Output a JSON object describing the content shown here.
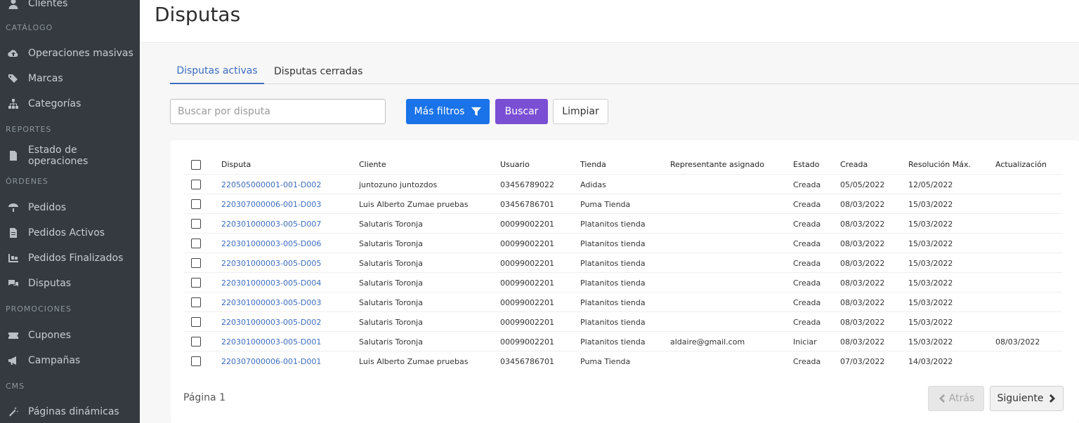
{
  "sidebar": {
    "top_item": {
      "label": "Clientes",
      "icon": "user-icon"
    },
    "sections": [
      {
        "title": "CATÁLOGO",
        "items": [
          {
            "label": "Operaciones masivas",
            "icon": "cloud-upload-icon"
          },
          {
            "label": "Marcas",
            "icon": "tags-icon"
          },
          {
            "label": "Categorías",
            "icon": "sitemap-icon"
          }
        ]
      },
      {
        "title": "REPORTES",
        "items": [
          {
            "label": "Estado de operaciones",
            "icon": "file-icon"
          }
        ]
      },
      {
        "title": "ÓRDENES",
        "items": [
          {
            "label": "Pedidos",
            "icon": "parachute-icon"
          },
          {
            "label": "Pedidos Activos",
            "icon": "file-text-icon"
          },
          {
            "label": "Pedidos Finalizados",
            "icon": "dolly-icon"
          },
          {
            "label": "Disputas",
            "icon": "comments-icon"
          }
        ]
      },
      {
        "title": "PROMOCIONES",
        "items": [
          {
            "label": "Cupones",
            "icon": "ticket-icon"
          },
          {
            "label": "Campañas",
            "icon": "bullhorn-icon"
          }
        ]
      },
      {
        "title": "CMS",
        "items": [
          {
            "label": "Páginas dinámicas",
            "icon": "magic-wand-icon"
          }
        ]
      }
    ]
  },
  "header": {
    "title": "Disputas"
  },
  "tabs": [
    {
      "label": "Disputas activas",
      "active": true
    },
    {
      "label": "Disputas cerradas",
      "active": false
    }
  ],
  "search": {
    "placeholder": "Buscar por disputa",
    "value": ""
  },
  "buttons": {
    "more_filters": "Más filtros",
    "search": "Buscar",
    "clear": "Limpiar"
  },
  "table": {
    "columns": [
      "Disputa",
      "Cliente",
      "Usuario",
      "Tienda",
      "Representante asignado",
      "Estado",
      "Creada",
      "Resolución Máx.",
      "Actualización"
    ],
    "rows": [
      [
        "220505000001-001-D002",
        "juntozuno juntozdos",
        "03456789022",
        "Adidas",
        "",
        "Creada",
        "05/05/2022",
        "12/05/2022",
        ""
      ],
      [
        "220307000006-001-D003",
        "Luis Alberto Zumae pruebas",
        "03456786701",
        "Puma Tienda",
        "",
        "Creada",
        "08/03/2022",
        "15/03/2022",
        ""
      ],
      [
        "220301000003-005-D007",
        "Salutaris Toronja",
        "00099002201",
        "Platanitos tienda",
        "",
        "Creada",
        "08/03/2022",
        "15/03/2022",
        ""
      ],
      [
        "220301000003-005-D006",
        "Salutaris Toronja",
        "00099002201",
        "Platanitos tienda",
        "",
        "Creada",
        "08/03/2022",
        "15/03/2022",
        ""
      ],
      [
        "220301000003-005-D005",
        "Salutaris Toronja",
        "00099002201",
        "Platanitos tienda",
        "",
        "Creada",
        "08/03/2022",
        "15/03/2022",
        ""
      ],
      [
        "220301000003-005-D004",
        "Salutaris Toronja",
        "00099002201",
        "Platanitos tienda",
        "",
        "Creada",
        "08/03/2022",
        "15/03/2022",
        ""
      ],
      [
        "220301000003-005-D003",
        "Salutaris Toronja",
        "00099002201",
        "Platanitos tienda",
        "",
        "Creada",
        "08/03/2022",
        "15/03/2022",
        ""
      ],
      [
        "220301000003-005-D002",
        "Salutaris Toronja",
        "00099002201",
        "Platanitos tienda",
        "",
        "Creada",
        "08/03/2022",
        "15/03/2022",
        ""
      ],
      [
        "220301000003-005-D001",
        "Salutaris Toronja",
        "00099002201",
        "Platanitos tienda",
        "aldaire@gmail.com",
        "Iniciar",
        "08/03/2022",
        "15/03/2022",
        "08/03/2022"
      ],
      [
        "220307000006-001-D001",
        "Luis Alberto Zumae pruebas",
        "03456786701",
        "Puma Tienda",
        "",
        "Creada",
        "07/03/2022",
        "14/03/2022",
        ""
      ]
    ]
  },
  "pagination": {
    "page_label": "Página 1",
    "prev": "Atrás",
    "next": "Siguiente"
  },
  "colors": {
    "sidebar_bg": "#343a40",
    "link": "#3c6dbd",
    "primary_blue": "#1a73e8",
    "purple": "#7a4fd4"
  }
}
